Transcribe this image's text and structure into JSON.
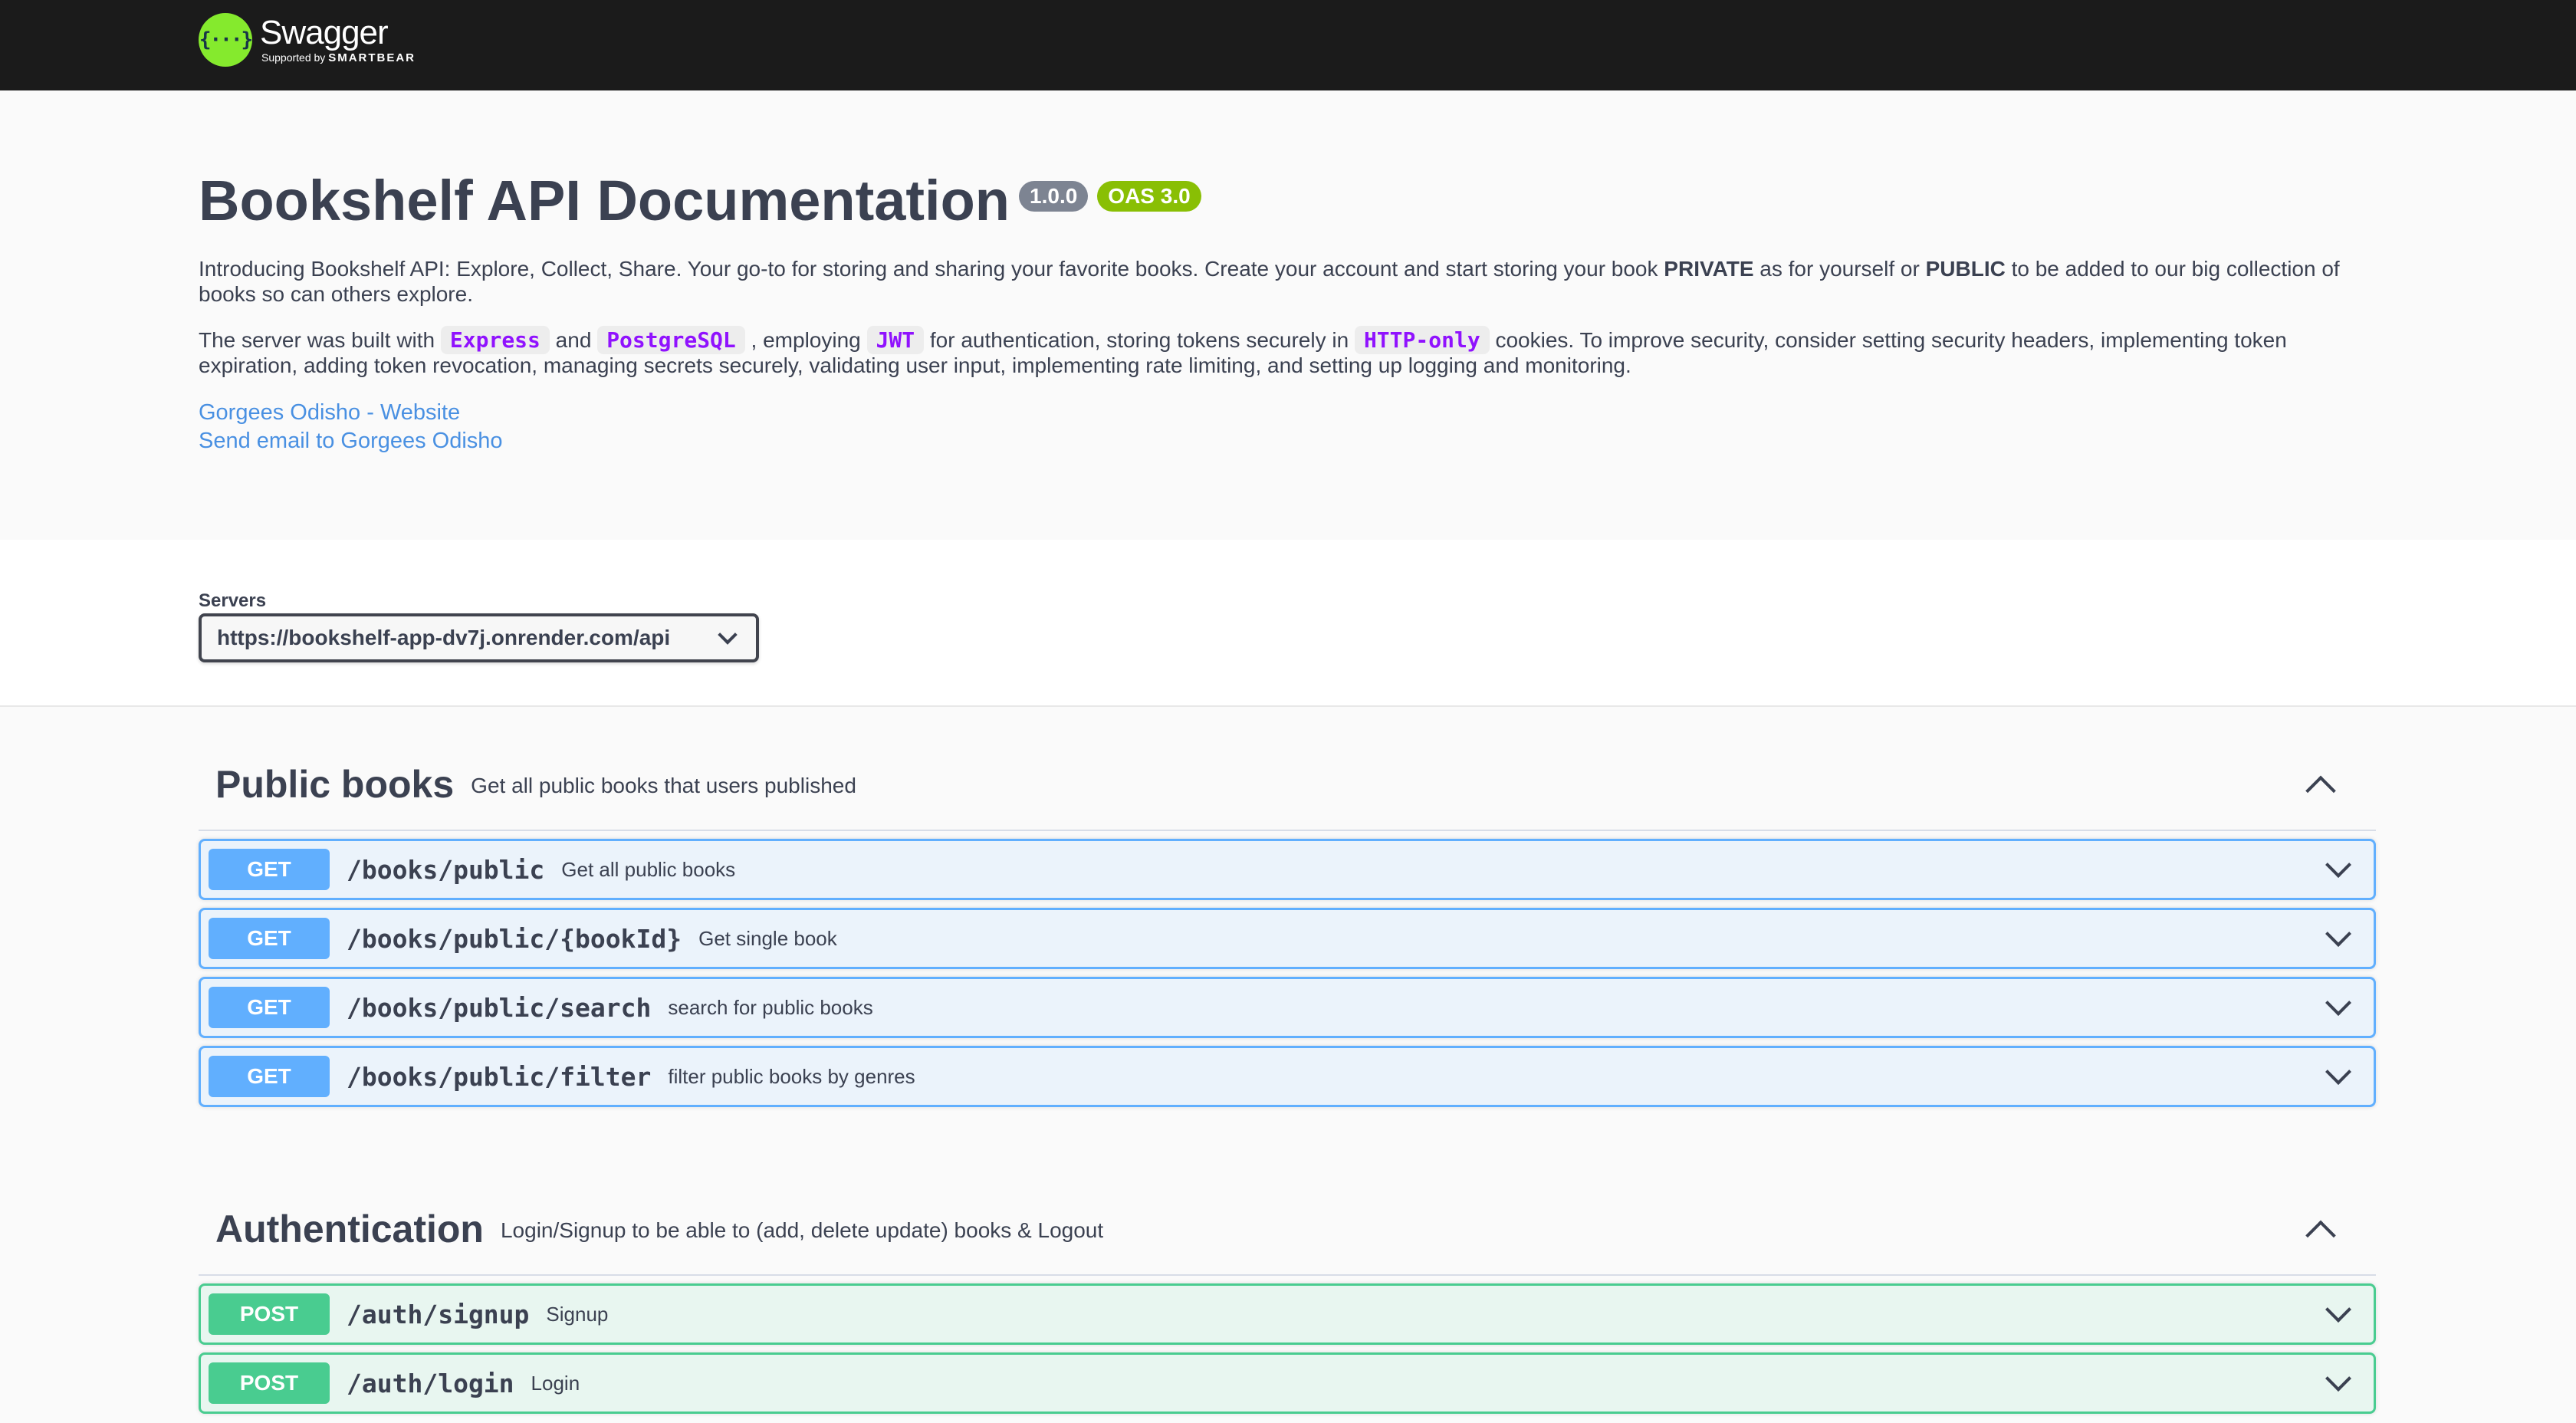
{
  "topbar": {
    "logo_mark": "{···}",
    "logo_name": "Swagger",
    "logo_supported_by": "Supported by",
    "logo_brand": "SMARTBEAR"
  },
  "info": {
    "title": "Bookshelf API Documentation",
    "version": "1.0.0",
    "oas": "OAS 3.0",
    "desc1_a": "Introducing Bookshelf API: Explore, Collect, Share. Your go-to for storing and sharing your favorite books. Create your account and start storing your book ",
    "desc1_private": "PRIVATE",
    "desc1_b": " as for yourself or ",
    "desc1_public": "PUBLIC",
    "desc1_c": " to be added to our big collection of books so can others explore.",
    "desc2_a": "The server was built with ",
    "code_express": "Express",
    "desc2_and": " and ",
    "code_postgres": "PostgreSQL",
    "desc2_b": " , employing ",
    "code_jwt": "JWT",
    "desc2_c": " for authentication, storing tokens securely in ",
    "code_httponly": "HTTP-only",
    "desc2_d": " cookies. To improve security, consider setting security headers, implementing token expiration, adding token revocation, managing secrets securely, validating user input, implementing rate limiting, and setting up logging and monitoring.",
    "link_website": "Gorgees Odisho - Website",
    "link_email": "Send email to Gorgees Odisho"
  },
  "servers": {
    "label": "Servers",
    "selected": "https://bookshelf-app-dv7j.onrender.com/api"
  },
  "sections": [
    {
      "name": "Public books",
      "description": "Get all public books that users published",
      "operations": [
        {
          "method": "GET",
          "path": "/books/public",
          "summary": "Get all public books"
        },
        {
          "method": "GET",
          "path": "/books/public/{bookId}",
          "summary": "Get single book"
        },
        {
          "method": "GET",
          "path": "/books/public/search",
          "summary": "search for public books"
        },
        {
          "method": "GET",
          "path": "/books/public/filter",
          "summary": "filter public books by genres"
        }
      ]
    },
    {
      "name": "Authentication",
      "description": "Login/Signup to be able to (add, delete update) books & Logout",
      "operations": [
        {
          "method": "POST",
          "path": "/auth/signup",
          "summary": "Signup"
        },
        {
          "method": "POST",
          "path": "/auth/login",
          "summary": "Login"
        }
      ]
    }
  ],
  "colors": {
    "get": "#61affe",
    "post": "#49cc90",
    "link": "#4990e2",
    "code": "#9012fe"
  }
}
